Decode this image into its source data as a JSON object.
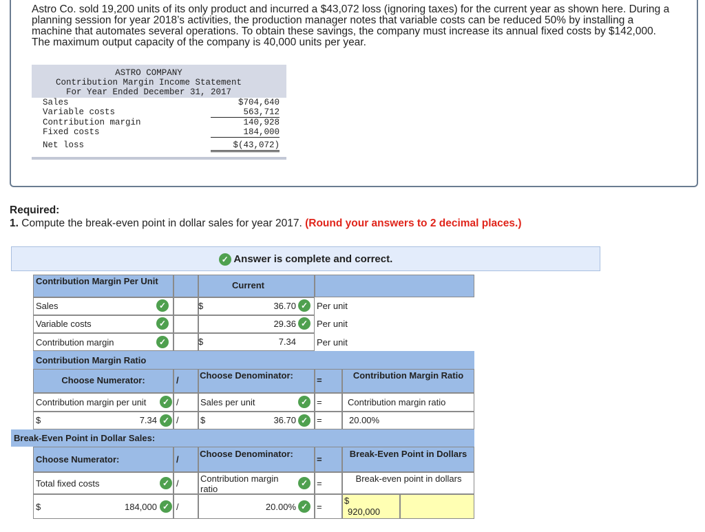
{
  "problem": {
    "text": "Astro Co. sold 19,200 units of its only product and incurred a $43,072 loss (ignoring taxes) for the current year as shown here. During a planning session for year 2018’s activities, the production manager notes that variable costs can be reduced 50% by installing a machine that automates several operations. To obtain these savings, the company must increase its annual fixed costs by $142,000. The maximum output capacity of the company is 40,000 units per year."
  },
  "statement": {
    "company": "ASTRO COMPANY",
    "title": "Contribution Margin Income Statement",
    "period": "For Year Ended December 31, 2017",
    "rows": [
      {
        "label": "Sales",
        "value": "$704,640"
      },
      {
        "label": "Variable costs",
        "value": "563,712"
      },
      {
        "label": "Contribution margin",
        "value": "140,928"
      },
      {
        "label": "Fixed costs",
        "value": "184,000"
      },
      {
        "label": "Net loss",
        "value": "$(43,072)"
      }
    ]
  },
  "required": {
    "title": "Required:",
    "q_prefix": "1.",
    "question": "Compute the break-even point in dollar sales for year 2017.",
    "round_note": "(Round your answers to 2 decimal places.)"
  },
  "banner": {
    "text": "Answer is complete and correct."
  },
  "cm_per_unit": {
    "heading": "Contribution Margin Per Unit",
    "col_header": "Current",
    "rows": [
      {
        "label": "Sales",
        "dollar": "$",
        "value": "36.70",
        "unit": "Per unit"
      },
      {
        "label": "Variable costs",
        "dollar": "",
        "value": "29.36",
        "unit": "Per unit"
      },
      {
        "label": "Contribution margin",
        "dollar": "$",
        "value": "7.34",
        "unit": "Per unit"
      }
    ]
  },
  "cm_ratio": {
    "heading": "Contribution Margin Ratio",
    "numerator_header": "Choose Numerator:",
    "div": "/",
    "denominator_header": "Choose Denominator:",
    "eq": "=",
    "result_header": "Contribution Margin Ratio",
    "numerator_label": "Contribution margin per unit",
    "denominator_label": "Sales per unit",
    "result_label": "Contribution margin ratio",
    "dollar": "$",
    "numerator_value": "7.34",
    "denominator_value": "36.70",
    "result_value": "20.00%"
  },
  "bep": {
    "heading": "Break-Even Point in Dollar Sales:",
    "numerator_header": "Choose Numerator:",
    "div": "/",
    "denominator_header": "Choose Denominator:",
    "eq": "=",
    "result_header": "Break-Even Point in Dollars",
    "numerator_label": "Total fixed costs",
    "denominator_label": "Contribution margin ratio",
    "result_label": "Break-even point in dollars",
    "dollar": "$",
    "numerator_value": "184,000",
    "denominator_value": "20.00%",
    "result_value": "920,000"
  },
  "icons": {
    "check": "check-circle-icon",
    "check_color": "#4fa04f"
  },
  "colors": {
    "header_bar": "#9bbbe6",
    "banner_bg": "#e3ecfb",
    "round_note": "#e0251b",
    "answer_yellow": "#ffffb3"
  }
}
